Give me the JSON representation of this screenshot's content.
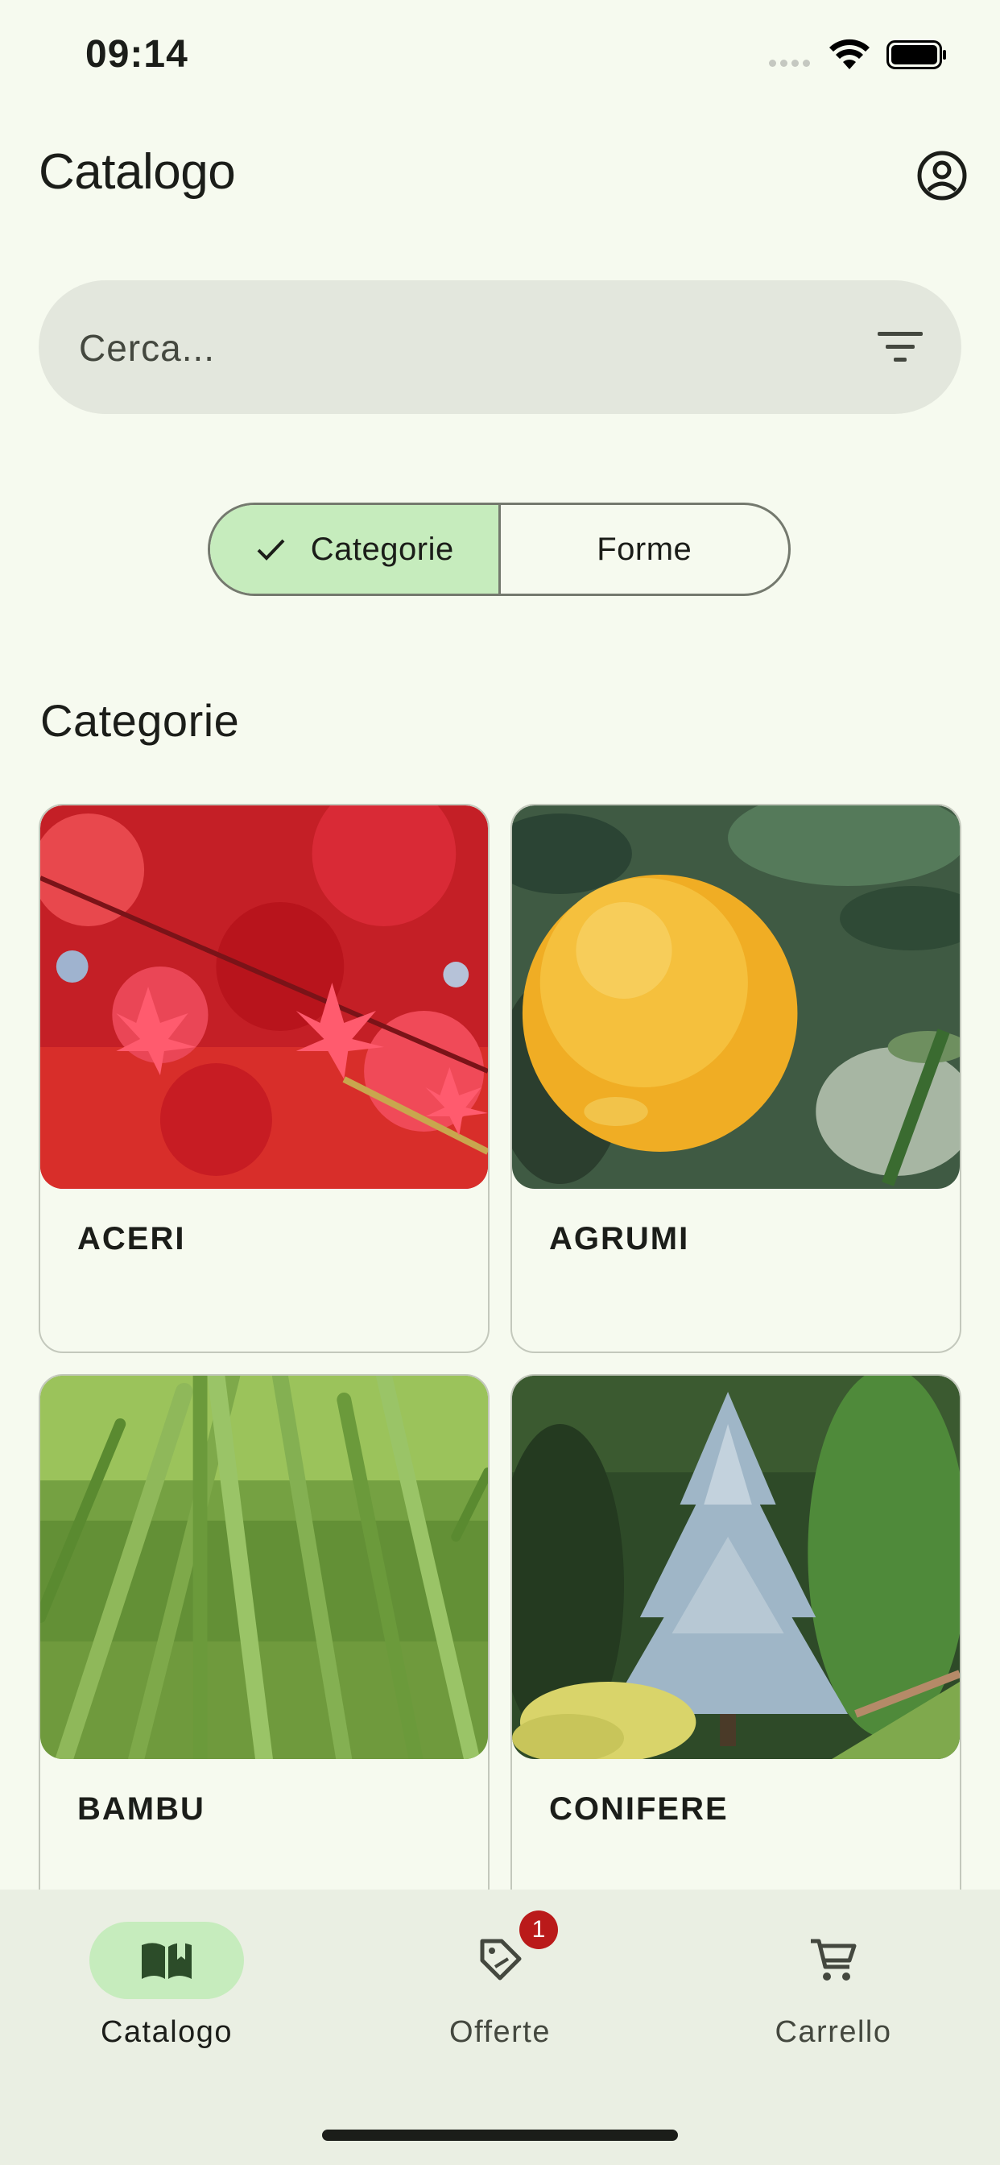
{
  "status_bar": {
    "time": "09:14"
  },
  "header": {
    "title": "Catalogo",
    "account_icon": "account-circle-icon"
  },
  "search": {
    "placeholder": "Cerca...",
    "filter_icon": "filter-list-icon"
  },
  "segmented": {
    "options": [
      {
        "label": "Categorie",
        "selected": true,
        "icon": "check-icon"
      },
      {
        "label": "Forme",
        "selected": false
      }
    ]
  },
  "section": {
    "title": "Categorie"
  },
  "categories": [
    {
      "label": "ACERI"
    },
    {
      "label": "AGRUMI"
    },
    {
      "label": "BAMBU"
    },
    {
      "label": "CONIFERE"
    }
  ],
  "bottom_nav": {
    "items": [
      {
        "label": "Catalogo",
        "icon": "book-open-icon",
        "active": true
      },
      {
        "label": "Offerte",
        "icon": "discount-tag-icon",
        "badge": "1",
        "active": false
      },
      {
        "label": "Carrello",
        "icon": "shopping-cart-icon",
        "active": false
      }
    ]
  },
  "colors": {
    "background": "#f6faef",
    "accent_container": "#c6ecbd",
    "badge": "#ba1a1a",
    "search_bg": "#e3e7dd",
    "nav_bg": "#eaefe3"
  }
}
